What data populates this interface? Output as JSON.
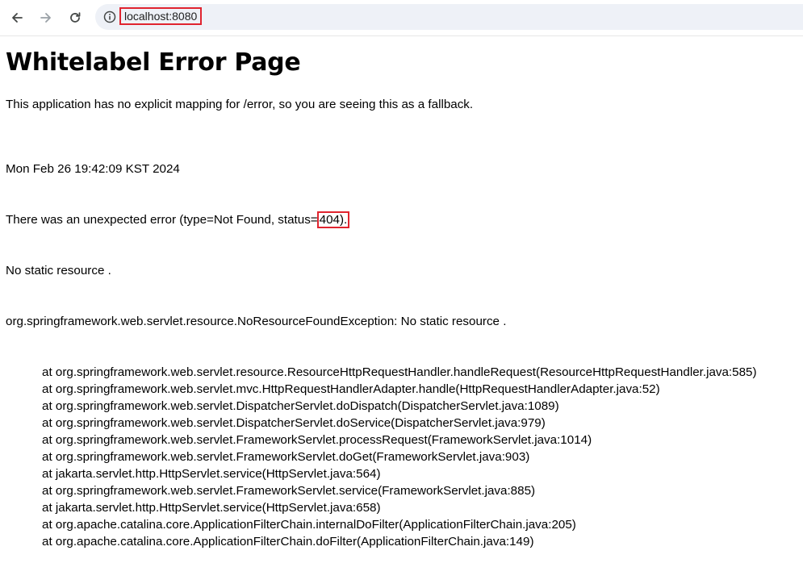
{
  "browser": {
    "url": "localhost:8080",
    "highlight_color": "#e0242f"
  },
  "page": {
    "title": "Whitelabel Error Page",
    "explanation": "This application has no explicit mapping for /error, so you are seeing this as a fallback.",
    "timestamp": "Mon Feb 26 19:42:09 KST 2024",
    "error_prefix": "There was an unexpected error (type=Not Found, status=",
    "status_code": "404).",
    "message": "No static resource .",
    "exception": "org.springframework.web.servlet.resource.NoResourceFoundException: No static resource .",
    "stack_trace": [
      "at org.springframework.web.servlet.resource.ResourceHttpRequestHandler.handleRequest(ResourceHttpRequestHandler.java:585)",
      "at org.springframework.web.servlet.mvc.HttpRequestHandlerAdapter.handle(HttpRequestHandlerAdapter.java:52)",
      "at org.springframework.web.servlet.DispatcherServlet.doDispatch(DispatcherServlet.java:1089)",
      "at org.springframework.web.servlet.DispatcherServlet.doService(DispatcherServlet.java:979)",
      "at org.springframework.web.servlet.FrameworkServlet.processRequest(FrameworkServlet.java:1014)",
      "at org.springframework.web.servlet.FrameworkServlet.doGet(FrameworkServlet.java:903)",
      "at jakarta.servlet.http.HttpServlet.service(HttpServlet.java:564)",
      "at org.springframework.web.servlet.FrameworkServlet.service(FrameworkServlet.java:885)",
      "at jakarta.servlet.http.HttpServlet.service(HttpServlet.java:658)",
      "at org.apache.catalina.core.ApplicationFilterChain.internalDoFilter(ApplicationFilterChain.java:205)",
      "at org.apache.catalina.core.ApplicationFilterChain.doFilter(ApplicationFilterChain.java:149)"
    ]
  },
  "icons": {
    "back": "back-arrow-icon",
    "forward": "forward-arrow-icon",
    "reload": "reload-icon",
    "info": "info-icon"
  }
}
